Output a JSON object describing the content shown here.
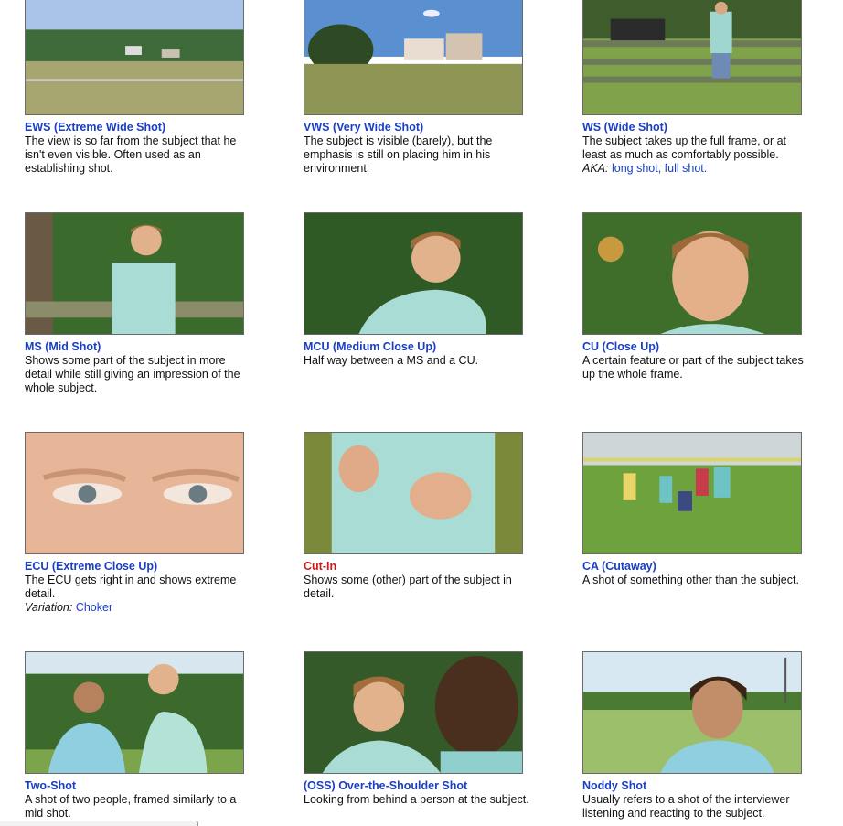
{
  "shots": [
    {
      "title": "EWS (Extreme Wide Shot)",
      "desc": "The view is so far from the subject that he isn't even visible. Often used as an establishing shot.",
      "image": "landscape-town-photo"
    },
    {
      "title": "VWS (Very Wide Shot)",
      "desc": "The subject is visible (barely), but the emphasis is still on placing him in his environment.",
      "image": "field-house-photo"
    },
    {
      "title": "WS (Wide Shot)",
      "desc": "The subject takes up the full frame, or at least as much as comfortably possible.",
      "note_label": "AKA:",
      "note_links": "long shot, full shot.",
      "image": "boy-fence-full-photo"
    },
    {
      "title": "MS (Mid Shot)",
      "desc": "Shows some part of the subject in more detail while still giving an impression of the whole subject.",
      "image": "boy-mid-photo"
    },
    {
      "title": "MCU (Medium Close Up)",
      "desc": "Half way between a MS and a CU.",
      "image": "boy-medium-close-photo"
    },
    {
      "title": "CU (Close Up)",
      "desc": "A certain feature or part of the subject takes up the whole frame.",
      "image": "boy-close-photo"
    },
    {
      "title": "ECU (Extreme Close Up)",
      "desc": "The ECU gets right in and shows extreme detail.",
      "note_label": "Variation:",
      "note_links": "Choker",
      "image": "eyes-photo"
    },
    {
      "title": "Cut-In",
      "desc": "Shows some (other) part of the subject in detail.",
      "image": "hands-photo",
      "red": true
    },
    {
      "title": "CA (Cutaway)",
      "desc": "A shot of something other than the subject.",
      "image": "children-playing-photo"
    },
    {
      "title": "Two-Shot",
      "desc": "A shot of two people, framed similarly to a mid shot.",
      "image": "two-boys-photo"
    },
    {
      "title": "(OSS) Over-the-Shoulder Shot",
      "desc": "Looking from behind a person at the subject.",
      "image": "over-shoulder-photo"
    },
    {
      "title": "Noddy Shot",
      "desc": "Usually refers to a shot of the interviewer listening and reacting to the subject.",
      "image": "boy-listening-photo"
    }
  ]
}
